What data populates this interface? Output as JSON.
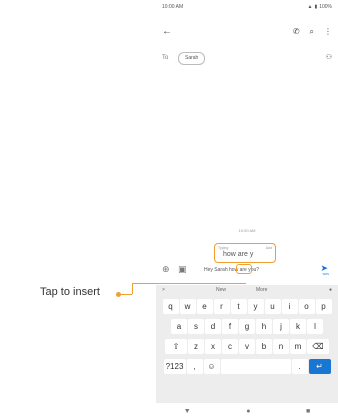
{
  "status": {
    "time": "10:00 AM",
    "battery": "100%"
  },
  "appbar": {
    "back_icon": "arrow-left",
    "call_icon": "phone",
    "search_icon": "search",
    "more_icon": "more-vert"
  },
  "to_row": {
    "label": "To",
    "chip": "Sarah"
  },
  "conversation": {
    "timestamp": "10:00 AM"
  },
  "suggestion": {
    "typing_label": "Typing",
    "text": "how are y",
    "add_label": "Add"
  },
  "compose": {
    "message": "Hey Sarah how are you?",
    "sms_label": "SMS"
  },
  "keyboard": {
    "top_items": [
      ">",
      "New",
      "More",
      "mic"
    ],
    "row1": [
      "q",
      "w",
      "e",
      "r",
      "t",
      "y",
      "u",
      "i",
      "o",
      "p"
    ],
    "row2": [
      "a",
      "s",
      "d",
      "f",
      "g",
      "h",
      "j",
      "k",
      "l"
    ],
    "row3": [
      "z",
      "x",
      "c",
      "v",
      "b",
      "n",
      "m"
    ],
    "bottom": {
      "num": "?123",
      "comma": ",",
      "period": "."
    }
  },
  "callout": {
    "label": "Tap to insert"
  },
  "colors": {
    "accent": "#f0a030",
    "send": "#1976d2"
  }
}
